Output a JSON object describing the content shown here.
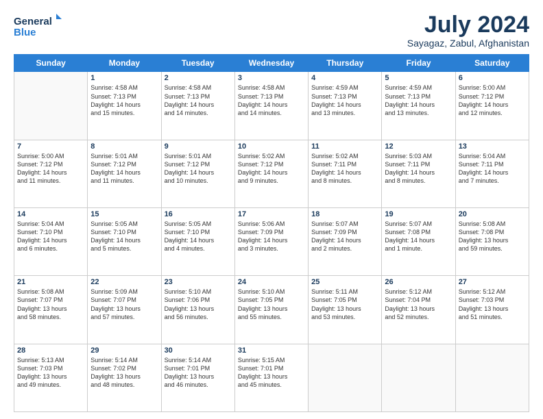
{
  "header": {
    "logo_line1": "General",
    "logo_line2": "Blue",
    "title": "July 2024",
    "subtitle": "Sayagaz, Zabul, Afghanistan"
  },
  "days_of_week": [
    "Sunday",
    "Monday",
    "Tuesday",
    "Wednesday",
    "Thursday",
    "Friday",
    "Saturday"
  ],
  "weeks": [
    [
      {
        "day": "",
        "info": ""
      },
      {
        "day": "1",
        "info": "Sunrise: 4:58 AM\nSunset: 7:13 PM\nDaylight: 14 hours\nand 15 minutes."
      },
      {
        "day": "2",
        "info": "Sunrise: 4:58 AM\nSunset: 7:13 PM\nDaylight: 14 hours\nand 14 minutes."
      },
      {
        "day": "3",
        "info": "Sunrise: 4:58 AM\nSunset: 7:13 PM\nDaylight: 14 hours\nand 14 minutes."
      },
      {
        "day": "4",
        "info": "Sunrise: 4:59 AM\nSunset: 7:13 PM\nDaylight: 14 hours\nand 13 minutes."
      },
      {
        "day": "5",
        "info": "Sunrise: 4:59 AM\nSunset: 7:13 PM\nDaylight: 14 hours\nand 13 minutes."
      },
      {
        "day": "6",
        "info": "Sunrise: 5:00 AM\nSunset: 7:12 PM\nDaylight: 14 hours\nand 12 minutes."
      }
    ],
    [
      {
        "day": "7",
        "info": "Sunrise: 5:00 AM\nSunset: 7:12 PM\nDaylight: 14 hours\nand 11 minutes."
      },
      {
        "day": "8",
        "info": "Sunrise: 5:01 AM\nSunset: 7:12 PM\nDaylight: 14 hours\nand 11 minutes."
      },
      {
        "day": "9",
        "info": "Sunrise: 5:01 AM\nSunset: 7:12 PM\nDaylight: 14 hours\nand 10 minutes."
      },
      {
        "day": "10",
        "info": "Sunrise: 5:02 AM\nSunset: 7:12 PM\nDaylight: 14 hours\nand 9 minutes."
      },
      {
        "day": "11",
        "info": "Sunrise: 5:02 AM\nSunset: 7:11 PM\nDaylight: 14 hours\nand 8 minutes."
      },
      {
        "day": "12",
        "info": "Sunrise: 5:03 AM\nSunset: 7:11 PM\nDaylight: 14 hours\nand 8 minutes."
      },
      {
        "day": "13",
        "info": "Sunrise: 5:04 AM\nSunset: 7:11 PM\nDaylight: 14 hours\nand 7 minutes."
      }
    ],
    [
      {
        "day": "14",
        "info": "Sunrise: 5:04 AM\nSunset: 7:10 PM\nDaylight: 14 hours\nand 6 minutes."
      },
      {
        "day": "15",
        "info": "Sunrise: 5:05 AM\nSunset: 7:10 PM\nDaylight: 14 hours\nand 5 minutes."
      },
      {
        "day": "16",
        "info": "Sunrise: 5:05 AM\nSunset: 7:10 PM\nDaylight: 14 hours\nand 4 minutes."
      },
      {
        "day": "17",
        "info": "Sunrise: 5:06 AM\nSunset: 7:09 PM\nDaylight: 14 hours\nand 3 minutes."
      },
      {
        "day": "18",
        "info": "Sunrise: 5:07 AM\nSunset: 7:09 PM\nDaylight: 14 hours\nand 2 minutes."
      },
      {
        "day": "19",
        "info": "Sunrise: 5:07 AM\nSunset: 7:08 PM\nDaylight: 14 hours\nand 1 minute."
      },
      {
        "day": "20",
        "info": "Sunrise: 5:08 AM\nSunset: 7:08 PM\nDaylight: 13 hours\nand 59 minutes."
      }
    ],
    [
      {
        "day": "21",
        "info": "Sunrise: 5:08 AM\nSunset: 7:07 PM\nDaylight: 13 hours\nand 58 minutes."
      },
      {
        "day": "22",
        "info": "Sunrise: 5:09 AM\nSunset: 7:07 PM\nDaylight: 13 hours\nand 57 minutes."
      },
      {
        "day": "23",
        "info": "Sunrise: 5:10 AM\nSunset: 7:06 PM\nDaylight: 13 hours\nand 56 minutes."
      },
      {
        "day": "24",
        "info": "Sunrise: 5:10 AM\nSunset: 7:05 PM\nDaylight: 13 hours\nand 55 minutes."
      },
      {
        "day": "25",
        "info": "Sunrise: 5:11 AM\nSunset: 7:05 PM\nDaylight: 13 hours\nand 53 minutes."
      },
      {
        "day": "26",
        "info": "Sunrise: 5:12 AM\nSunset: 7:04 PM\nDaylight: 13 hours\nand 52 minutes."
      },
      {
        "day": "27",
        "info": "Sunrise: 5:12 AM\nSunset: 7:03 PM\nDaylight: 13 hours\nand 51 minutes."
      }
    ],
    [
      {
        "day": "28",
        "info": "Sunrise: 5:13 AM\nSunset: 7:03 PM\nDaylight: 13 hours\nand 49 minutes."
      },
      {
        "day": "29",
        "info": "Sunrise: 5:14 AM\nSunset: 7:02 PM\nDaylight: 13 hours\nand 48 minutes."
      },
      {
        "day": "30",
        "info": "Sunrise: 5:14 AM\nSunset: 7:01 PM\nDaylight: 13 hours\nand 46 minutes."
      },
      {
        "day": "31",
        "info": "Sunrise: 5:15 AM\nSunset: 7:01 PM\nDaylight: 13 hours\nand 45 minutes."
      },
      {
        "day": "",
        "info": ""
      },
      {
        "day": "",
        "info": ""
      },
      {
        "day": "",
        "info": ""
      }
    ]
  ]
}
